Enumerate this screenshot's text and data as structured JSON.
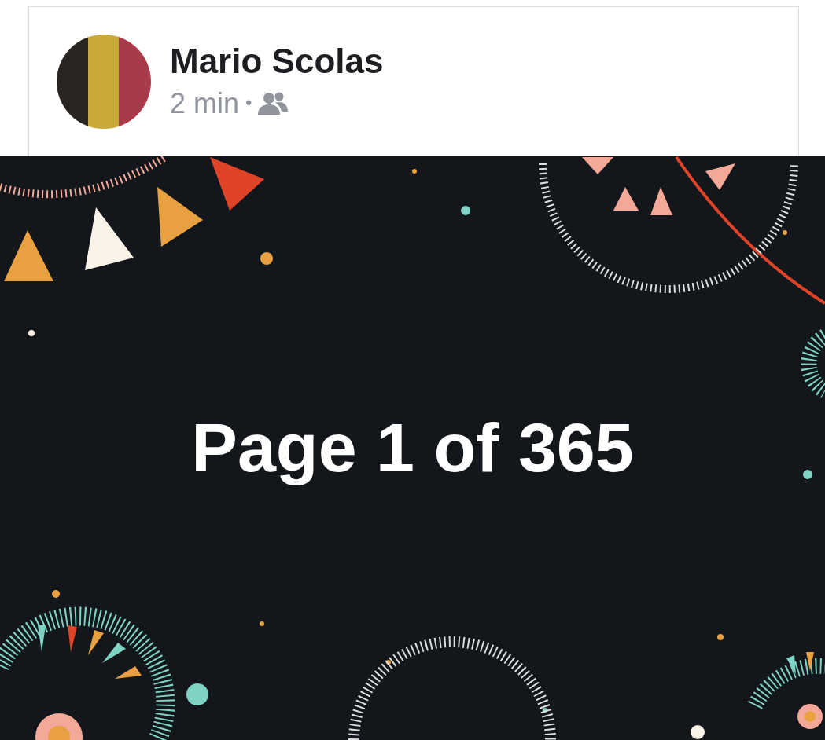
{
  "post": {
    "author": "Mario Scolas",
    "time": "2 min",
    "separator": "•",
    "text": "Page 1 of 365"
  }
}
